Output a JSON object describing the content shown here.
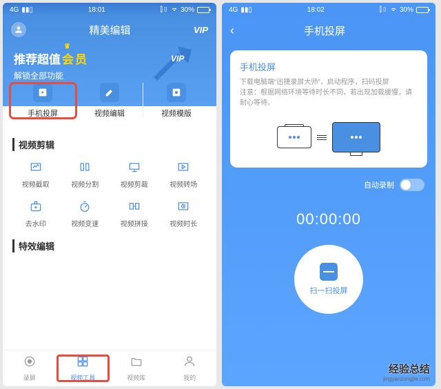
{
  "left": {
    "status": {
      "signal": "4G",
      "time": "18:01",
      "battery": "30%",
      "vib": "⫿▯"
    },
    "header": {
      "title": "精美编辑",
      "vip": "VIP"
    },
    "banner": {
      "title_pre": "推荐超值",
      "title_mid": "会",
      "title_suf": "员",
      "sub": "解锁全部功能",
      "badge": "VIP"
    },
    "card": [
      {
        "label": "手机投屏",
        "highlight": true
      },
      {
        "label": "视频编辑",
        "highlight": false
      },
      {
        "label": "视频模版",
        "highlight": false
      }
    ],
    "section1": {
      "title": "视频剪辑",
      "items": [
        {
          "label": "视频截取"
        },
        {
          "label": "视频分割"
        },
        {
          "label": "视频剪裁"
        },
        {
          "label": "视频转场"
        },
        {
          "label": "去水印"
        },
        {
          "label": "视频变速"
        },
        {
          "label": "视频拼接"
        },
        {
          "label": "视频时长"
        }
      ]
    },
    "section2": {
      "title": "特效编辑"
    },
    "nav": [
      {
        "label": "录屏",
        "active": false
      },
      {
        "label": "视频工具",
        "active": true,
        "highlight": true
      },
      {
        "label": "视频库",
        "active": false
      },
      {
        "label": "我的",
        "active": false
      }
    ]
  },
  "right": {
    "status": {
      "signal": "4G",
      "time": "18:02",
      "battery": "30%",
      "vib": "⫿▯"
    },
    "title": "手机投屏",
    "info": {
      "title": "手机投屏",
      "desc": "下载电脑端“迅捷录屏大师”，启动程序，扫码投屏\n注意：根据网络环境等待时长不同，若出现加载缓慢，请耐心等待。"
    },
    "auto_record": "自动录制",
    "timer": "00:00:00",
    "scan_label": "扫一扫投屏"
  },
  "watermark": {
    "main": "经验总结",
    "sub": "jingyanzongjie.com"
  }
}
